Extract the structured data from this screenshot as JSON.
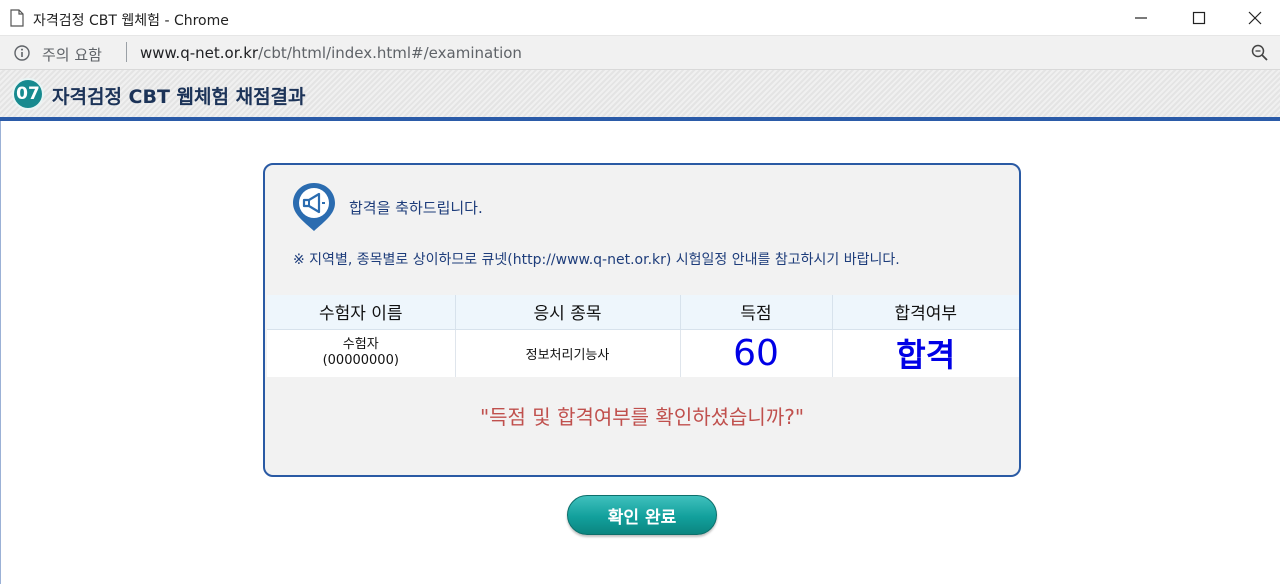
{
  "window": {
    "title": "자격검정 CBT 웹체험 - Chrome"
  },
  "address_bar": {
    "security_label": "주의 요함",
    "url_host": "www.q-net.or.kr",
    "url_path": "/cbt/html/index.html#/examination"
  },
  "page_header": {
    "step_number": "07",
    "title": "자격검정 CBT 웹체험 채점결과"
  },
  "panel": {
    "congrats": "합격을 축하드립니다.",
    "notice": "※ 지역별, 종목별로 상이하므로 큐넷(http://www.q-net.or.kr) 시험일정 안내를 참고하시기 바랍니다.",
    "table": {
      "headers": [
        "수험자 이름",
        "응시 종목",
        "득점",
        "합격여부"
      ],
      "row": {
        "name": "수험자",
        "id": "(00000000)",
        "subject": "정보처리기능사",
        "score": "60",
        "result": "합격"
      }
    },
    "question": "\"득점 및 합격여부를 확인하셨습니까?\""
  },
  "confirm_button": {
    "label": "확인 완료"
  },
  "colors": {
    "accent": "#2b5ba8",
    "button": "#12a09c",
    "score": "#0000e6",
    "question": "#c0504d"
  }
}
